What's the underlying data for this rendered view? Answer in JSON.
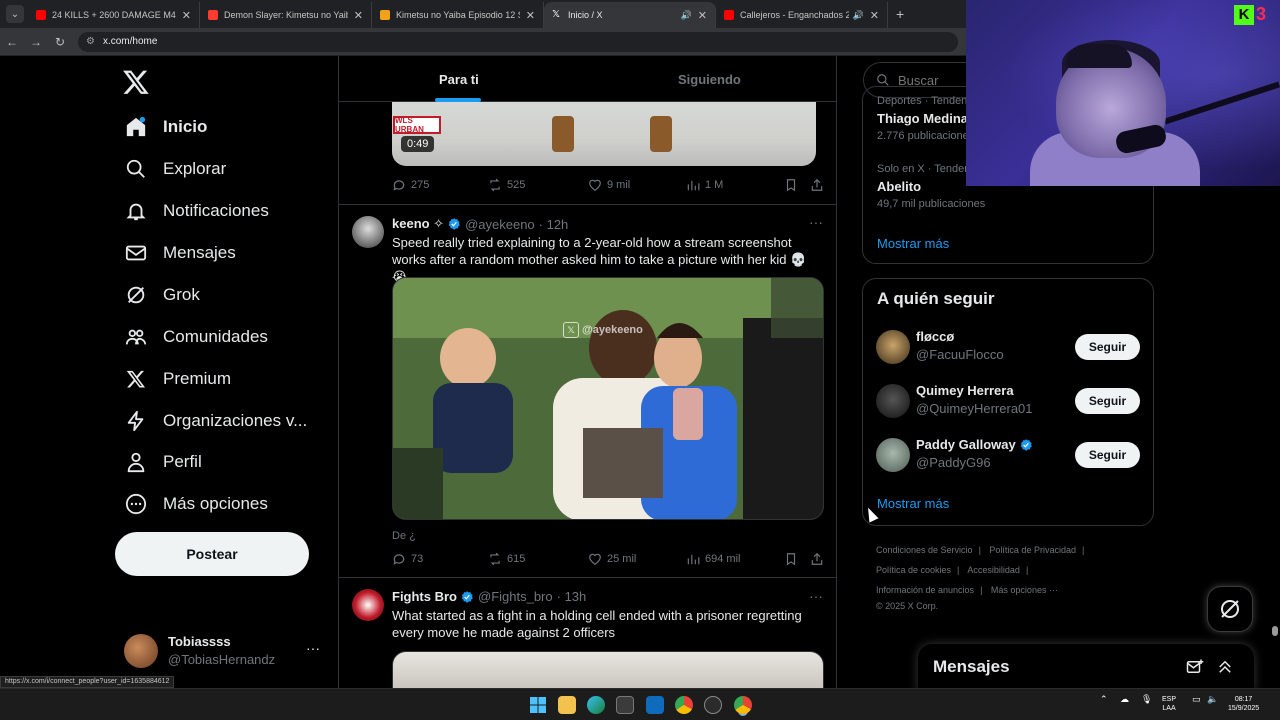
{
  "browser": {
    "tabs": [
      {
        "title": "24 KILLS + 2600 DAMAGE M41...",
        "favicon_color": "#ff0000",
        "audio": false,
        "active": false
      },
      {
        "title": "Demon Slayer: Kimetsu no Yaib...",
        "favicon_color": "#ff3b30",
        "audio": false,
        "active": false
      },
      {
        "title": "Kimetsu no Yaiba Episodio 12 S...",
        "favicon_color": "#f4a11a",
        "audio": false,
        "active": false
      },
      {
        "title": "Inicio / X",
        "favicon_color": "#ffffff",
        "audio": true,
        "active": true
      },
      {
        "title": "Callejeros - Enganchados 2...",
        "favicon_color": "#ff0000",
        "audio": true,
        "active": false
      }
    ],
    "url": "x.com/home",
    "status_url": "https://x.com/i/connect_people?user_id=1635884612"
  },
  "sidebar": {
    "items": [
      {
        "label": "Inicio",
        "icon": "home-icon",
        "active": true
      },
      {
        "label": "Explorar",
        "icon": "search-icon",
        "active": false
      },
      {
        "label": "Notificaciones",
        "icon": "bell-icon",
        "active": false
      },
      {
        "label": "Mensajes",
        "icon": "mail-icon",
        "active": false
      },
      {
        "label": "Grok",
        "icon": "grok-icon",
        "active": false
      },
      {
        "label": "Comunidades",
        "icon": "people-icon",
        "active": false
      },
      {
        "label": "Premium",
        "icon": "x-icon",
        "active": false
      },
      {
        "label": "Organizaciones v...",
        "icon": "lightning-icon",
        "active": false
      },
      {
        "label": "Perfil",
        "icon": "person-icon",
        "active": false
      },
      {
        "label": "Más opciones",
        "icon": "more-circle-icon",
        "active": false
      }
    ],
    "post_button": "Postear",
    "account": {
      "name": "Tobiassss",
      "handle": "@TobiasHernandz"
    }
  },
  "feed": {
    "tabs": [
      "Para ti",
      "Siguiendo"
    ],
    "top_media": {
      "badge": "WLS URBAN",
      "duration": "0:49"
    },
    "top_actions": {
      "replies": "275",
      "reposts": "525",
      "likes": "9 mil",
      "views": "1 M"
    },
    "post1": {
      "name": "keeno ✧",
      "handle": "@ayekeeno",
      "time": "· 12h",
      "text": "Speed really tried explaining to a 2-year-old how a stream screenshot works after a random mother asked him to take a picture with her kid 💀😭",
      "watermark": "@ayekeeno",
      "reply_text": "De ¿",
      "actions": {
        "replies": "73",
        "reposts": "615",
        "likes": "25 mil",
        "views": "694 mil"
      }
    },
    "post2": {
      "name": "Fights Bro",
      "handle": "@Fights_bro",
      "time": "· 13h",
      "text": "What started as a fight in a holding cell ended with a prisoner regretting every move he made against 2 officers"
    }
  },
  "right": {
    "search_placeholder": "Buscar",
    "trends": [
      {
        "meta": "Deportes · Tendencia",
        "name": "Thiago Medina",
        "count": "2.776 publicaciones"
      },
      {
        "meta": "Solo en X · Tendencia",
        "name": "Abelito",
        "count": "49,7 mil publicaciones"
      }
    ],
    "trends_more": "Mostrar más",
    "who_to_follow": {
      "title": "A quién seguir",
      "accounts": [
        {
          "name": "fløccø",
          "handle": "@FacuuFlocco",
          "verified": false,
          "avatar_color": "#6b5a3a"
        },
        {
          "name": "Quimey Herrera",
          "handle": "@QuimeyHerrera01",
          "verified": false,
          "avatar_color": "#2a2a2a"
        },
        {
          "name": "Paddy Galloway",
          "handle": "@PaddyG96",
          "verified": true,
          "avatar_color": "#7a8a80"
        }
      ],
      "follow_label": "Seguir",
      "more": "Mostrar más"
    },
    "footer": {
      "links_row1": [
        "Condiciones de Servicio",
        "Política de Privacidad"
      ],
      "links_row2": [
        "Política de cookies",
        "Accesibilidad"
      ],
      "links_row3": [
        "Información de anuncios",
        "Más opciones ···"
      ],
      "copyright": "© 2025 X Corp."
    },
    "messages_drawer": "Mensajes"
  },
  "stream_overlay": {
    "kick_count": "3"
  },
  "taskbar": {
    "lang_top": "ESP",
    "lang_bottom": "LAA",
    "time": "08:17",
    "date": "15/9/2025"
  },
  "colors": {
    "accent": "#1d9bf0",
    "background": "#000000",
    "text": "#e7e9ea",
    "muted": "#71767b"
  }
}
